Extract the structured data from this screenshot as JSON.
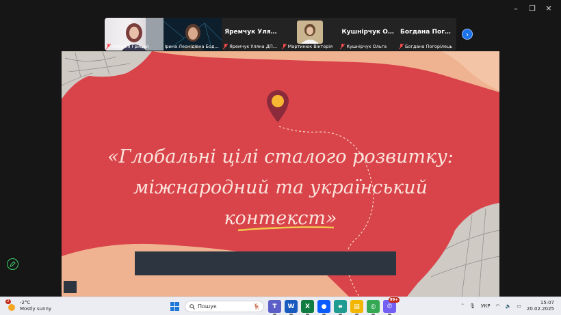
{
  "window_controls": {
    "minimize": "–",
    "maximize": "❐",
    "close": "✕"
  },
  "participants": [
    {
      "name": "Наталія Грицай",
      "title": "",
      "kind": "video",
      "active": false
    },
    {
      "name": "Ірина Леонідівна Боднар...",
      "title": "",
      "kind": "video",
      "active": true
    },
    {
      "name": "Яремчук Уляна ДПНП...",
      "title": "Яремчук  Уляна...",
      "kind": "name",
      "active": false
    },
    {
      "name": "Мартинюк Вікторія",
      "title": "",
      "kind": "avatar",
      "active": false
    },
    {
      "name": "Кушнірчук Ольга",
      "title": "Кушнірчук Ольга",
      "kind": "name",
      "active": false
    },
    {
      "name": "Богдана Погорілець",
      "title": "Богдана Погорі...",
      "kind": "name",
      "active": false
    }
  ],
  "slide": {
    "title_line1": "«Глобальні цілі сталого розвитку:",
    "title_line2": "міжнародний та український",
    "title_line3": "контекст»"
  },
  "taskbar": {
    "weather_temp": "-2°C",
    "weather_desc": "Mostly sunny",
    "weather_badge": "2",
    "search_placeholder": "Пошук",
    "apps": [
      {
        "name": "teams",
        "label": "T",
        "color": "#5b5fc7",
        "badge": ""
      },
      {
        "name": "word",
        "label": "W",
        "color": "#185abd",
        "badge": ""
      },
      {
        "name": "excel",
        "label": "X",
        "color": "#107c41",
        "badge": ""
      },
      {
        "name": "zoom",
        "label": "●",
        "color": "#0b5cff",
        "badge": ""
      },
      {
        "name": "edge",
        "label": "e",
        "color": "#1f9c8f",
        "badge": ""
      },
      {
        "name": "file-explorer",
        "label": "▤",
        "color": "#f2b705",
        "badge": ""
      },
      {
        "name": "chrome",
        "label": "◎",
        "color": "#34a853",
        "badge": ""
      },
      {
        "name": "viber",
        "label": "✆",
        "color": "#7360f2",
        "badge": "99+"
      }
    ],
    "language": "УКР",
    "time": "15:07",
    "date": "20.02.2025"
  },
  "colors": {
    "slide_red": "#d9434a",
    "peach": "#f0b391",
    "dark_bar": "#2d3640",
    "active_border": "#3ecf6a"
  }
}
